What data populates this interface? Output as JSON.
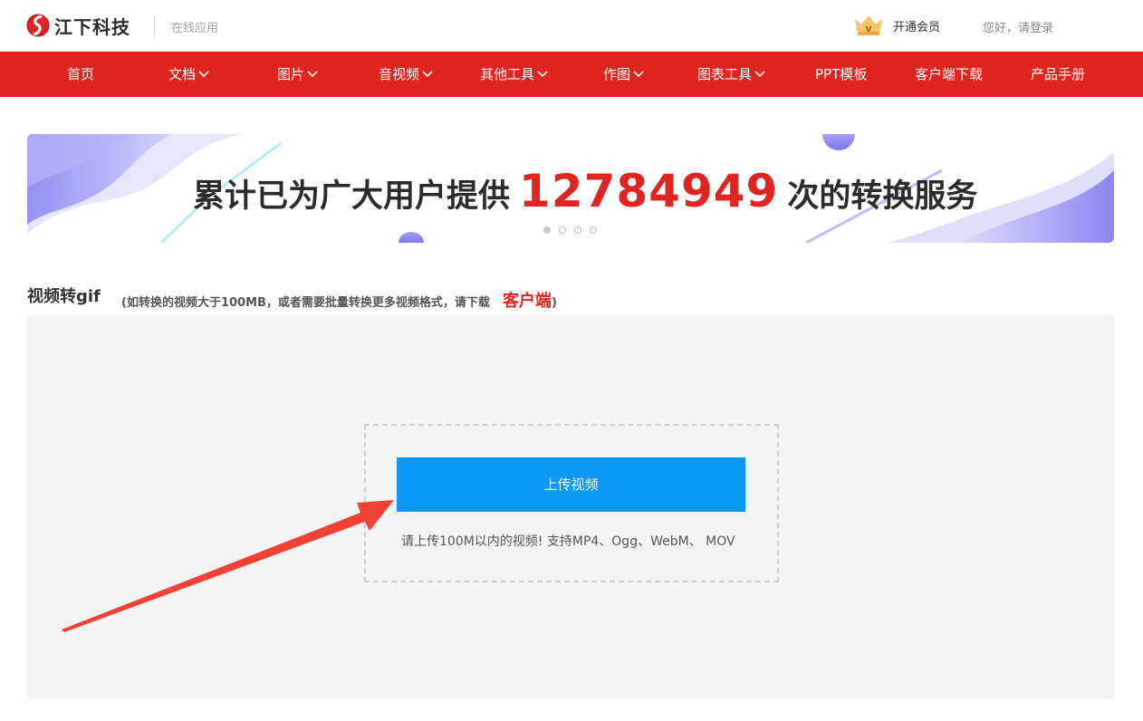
{
  "header": {
    "brand": "江下科技",
    "subtitle": "在线应用",
    "vip_label": "开通会员",
    "login_label": "您好，请登录"
  },
  "nav": {
    "items": [
      {
        "label": "首页",
        "dropdown": false
      },
      {
        "label": "文档",
        "dropdown": true
      },
      {
        "label": "图片",
        "dropdown": true
      },
      {
        "label": "音视频",
        "dropdown": true
      },
      {
        "label": "其他工具",
        "dropdown": true
      },
      {
        "label": "作图",
        "dropdown": true
      },
      {
        "label": "图表工具",
        "dropdown": true
      },
      {
        "label": "PPT模板",
        "dropdown": false
      },
      {
        "label": "客户端下载",
        "dropdown": false
      },
      {
        "label": "产品手册",
        "dropdown": false
      }
    ]
  },
  "banner": {
    "prefix": "累计已为广大用户提供",
    "count": "12784949",
    "suffix": "次的转换服务",
    "slides": 4,
    "active_slide": 1
  },
  "section": {
    "title": "视频转gif",
    "note": "(如转换的视频大于100MB，或者需要批量转换更多视频格式，请下载",
    "client_link": "客户端",
    "note_close": ")"
  },
  "upload": {
    "button_label": "上传视频",
    "hint": "请上传100M以内的视频!  支持MP4、Ogg、WebM、 MOV"
  },
  "colors": {
    "brand_red": "#e0241f",
    "upload_blue": "#0b98f7",
    "annotation_arrow": "#ef4136"
  }
}
